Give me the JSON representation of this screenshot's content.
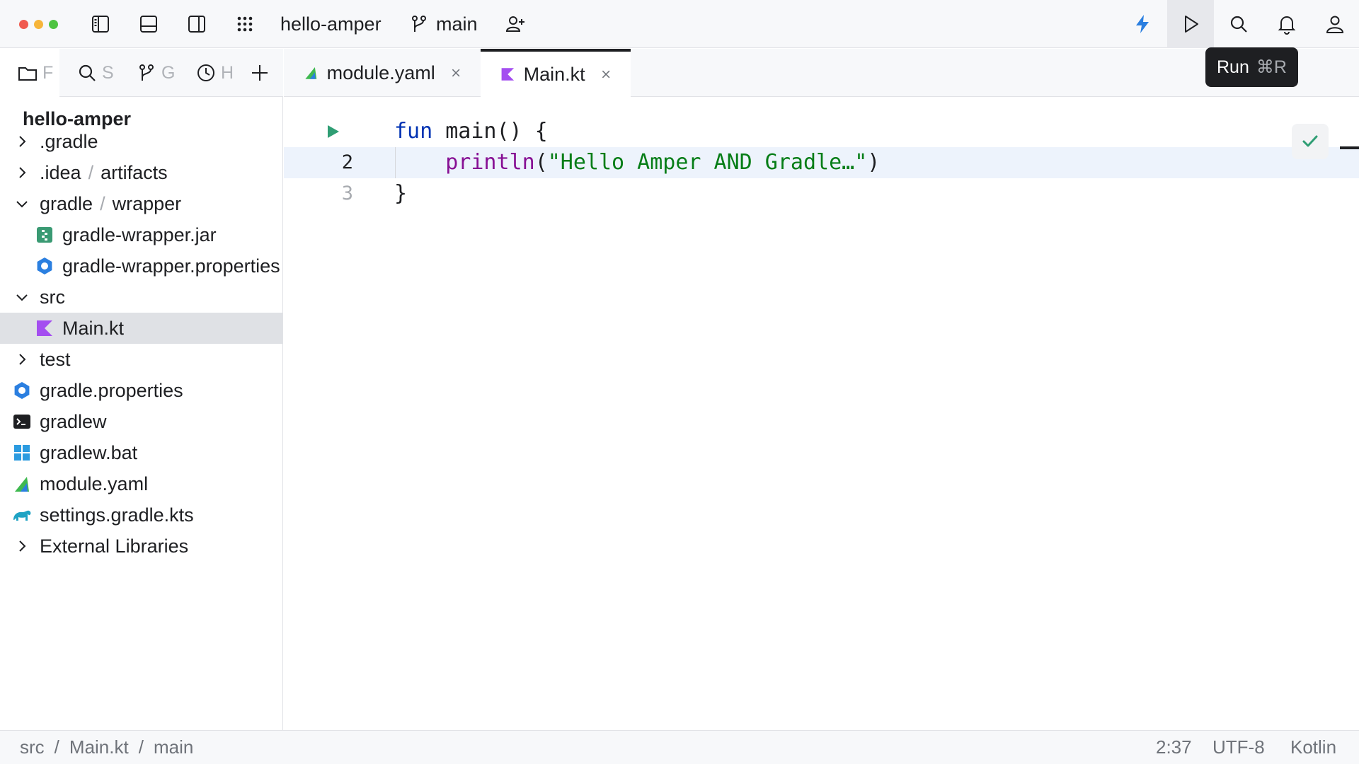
{
  "window": {
    "project_name": "hello-amper",
    "branch": "main"
  },
  "toolbar": {
    "icons": [
      "sidebar-left-icon",
      "panel-bottom-icon",
      "sidebar-right-icon",
      "grid-menu-icon",
      "add-user-icon",
      "lightning-icon",
      "run-icon",
      "search-icon",
      "bell-icon",
      "profile-icon"
    ]
  },
  "tooltip": {
    "label": "Run",
    "shortcut": "⌘R"
  },
  "tool_tabs": [
    {
      "icon": "folder-icon",
      "label": "F"
    },
    {
      "icon": "search-icon",
      "label": "S"
    },
    {
      "icon": "branch-icon",
      "label": "G"
    },
    {
      "icon": "clock-icon",
      "label": "H"
    }
  ],
  "project": {
    "title": "hello-amper",
    "tree": [
      {
        "label": ".gradle",
        "expanded": false
      },
      {
        "label": ".idea",
        "sub": "artifacts",
        "expanded": false
      },
      {
        "label": "gradle",
        "sub": "wrapper",
        "expanded": true
      },
      {
        "label": "gradle-wrapper.jar",
        "icon": "jar-icon"
      },
      {
        "label": "gradle-wrapper.properties",
        "icon": "properties-icon"
      },
      {
        "label": "src",
        "expanded": true
      },
      {
        "label": "Main.kt",
        "icon": "kotlin-icon",
        "selected": true
      },
      {
        "label": "test",
        "expanded": false
      },
      {
        "label": "gradle.properties",
        "icon": "properties-icon"
      },
      {
        "label": "gradlew",
        "icon": "terminal-icon"
      },
      {
        "label": "gradlew.bat",
        "icon": "windows-icon"
      },
      {
        "label": "module.yaml",
        "icon": "amper-icon"
      },
      {
        "label": "settings.gradle.kts",
        "icon": "gradle-elephant-icon"
      },
      {
        "label": "External Libraries",
        "expanded": false
      }
    ]
  },
  "editor_tabs": [
    {
      "label": "module.yaml",
      "icon": "amper-icon",
      "active": false
    },
    {
      "label": "Main.kt",
      "icon": "kotlin-icon",
      "active": true
    }
  ],
  "editor": {
    "line_numbers": [
      "",
      "2",
      "3"
    ],
    "lines": {
      "l1_kw": "fun",
      "l1_rest": " main() {",
      "l2_indent": "    ",
      "l2_fn": "println",
      "l2_open": "(",
      "l2_str": "\"Hello Amper AND Gradle…\"",
      "l2_close": ")",
      "l3": "}"
    }
  },
  "statusbar": {
    "breadcrumbs": [
      "src",
      "/",
      "Main.kt",
      "/",
      "main"
    ],
    "position": "2:37",
    "encoding": "UTF-8",
    "language": "Kotlin"
  },
  "colors": {
    "kotlin_purple": "#a44ef0",
    "amper_green": "#3fb950",
    "run_green": "#2f9e74",
    "lightning_blue": "#2b7fe0"
  }
}
